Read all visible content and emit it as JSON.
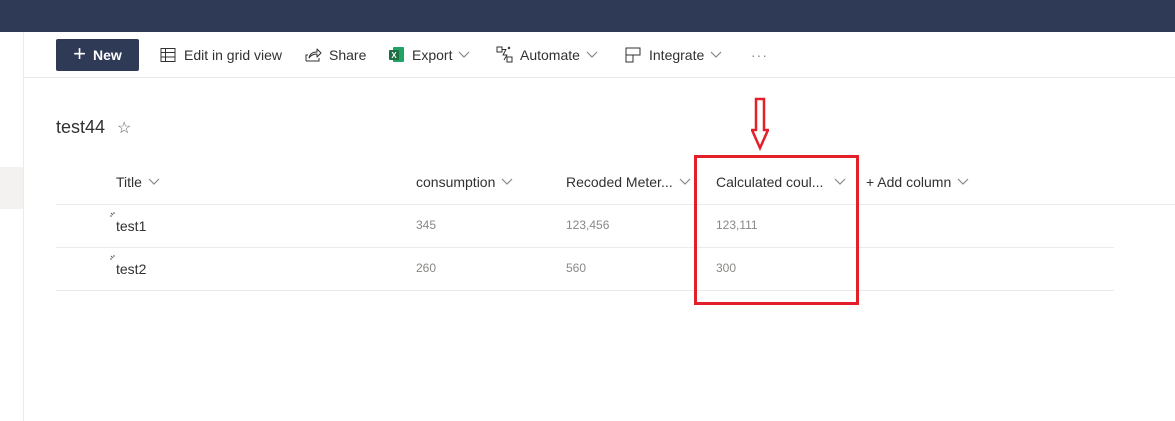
{
  "toolbar": {
    "new_label": "New",
    "edit_grid_label": "Edit in grid view",
    "share_label": "Share",
    "export_label": "Export",
    "automate_label": "Automate",
    "integrate_label": "Integrate",
    "more_label": "···"
  },
  "list": {
    "title": "test44",
    "star": "☆"
  },
  "columns": {
    "title": "Title",
    "consumption": "consumption",
    "recoded": "Recoded Meter...",
    "calculated": "Calculated coul...",
    "add": "+ Add column"
  },
  "rows": [
    {
      "title": "test1",
      "consumption": "345",
      "recoded": "123,456",
      "calculated": "123,111"
    },
    {
      "title": "test2",
      "consumption": "260",
      "recoded": "560",
      "calculated": "300"
    }
  ],
  "colors": {
    "suite_bar": "#2e3a56",
    "annotation": "#e3202a",
    "excel_green": "#1d6f42"
  },
  "icons": [
    "grid-view-icon",
    "share-icon",
    "excel-icon",
    "automate-icon",
    "integrate-icon",
    "chevron-down-icon",
    "star-icon",
    "loading-icon",
    "annotation-arrow"
  ]
}
